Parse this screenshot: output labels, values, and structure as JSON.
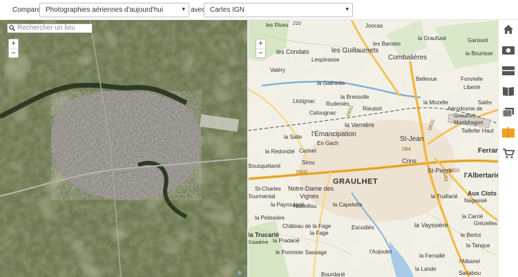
{
  "compare": {
    "label": "Comparer",
    "left_layer": "Photographies aériennes d'aujourd'hui",
    "sep": "avec",
    "right_layer": "Cartes IGN"
  },
  "search": {
    "placeholder": "Rechercher un lieu"
  },
  "zoom": {
    "in": "+",
    "out": "−"
  },
  "map_labels": [
    {
      "t": "les Rives"
    },
    {
      "t": "210"
    },
    {
      "t": "Joncas"
    },
    {
      "t": "la Graufusé"
    },
    {
      "t": "Garissol"
    },
    {
      "t": "les Condats"
    },
    {
      "t": "les Guillaumets"
    },
    {
      "t": "les Barotes"
    },
    {
      "t": "Combalières"
    },
    {
      "t": "la Bourisse"
    },
    {
      "t": "Lespinasse"
    },
    {
      "t": "Valéry"
    },
    {
      "t": "Bellevue"
    },
    {
      "t": "Fonvielle"
    },
    {
      "t": "Liberté"
    },
    {
      "t": "la Galinette"
    },
    {
      "t": "la Bressolle"
    },
    {
      "t": "Rudeniès"
    },
    {
      "t": "Lézignac"
    },
    {
      "t": "la Mozelle"
    },
    {
      "t": "Salès"
    },
    {
      "t": "Aérodrome de"
    },
    {
      "t": "Graulhet-"
    },
    {
      "t": "Montdragon"
    },
    {
      "t": "Catougnac"
    },
    {
      "t": "Rieutort"
    },
    {
      "t": "la Vernière"
    },
    {
      "t": "Taillefer Haut"
    },
    {
      "t": "l'Émancipation"
    },
    {
      "t": "la Salle"
    },
    {
      "t": "St-Jean"
    },
    {
      "t": "En Gach"
    },
    {
      "t": "Ferran"
    },
    {
      "t": "la Redondié"
    },
    {
      "t": "Carivel"
    },
    {
      "t": "Crins"
    },
    {
      "t": "Bousquétarié"
    },
    {
      "t": "Sirou"
    },
    {
      "t": "St-Pierre"
    },
    {
      "t": "l'Albertarié"
    },
    {
      "t": "GRAULHET"
    },
    {
      "t": "St-Charles"
    },
    {
      "t": "Notre-Dame des"
    },
    {
      "t": "Vignes"
    },
    {
      "t": "Aux Clots"
    },
    {
      "t": "Tourmental"
    },
    {
      "t": "la Payroularié"
    },
    {
      "t": "Nabeillou"
    },
    {
      "t": "la Capelette"
    },
    {
      "t": "la Truillarié"
    },
    {
      "t": "Nagassié"
    },
    {
      "t": "la Pelissière"
    },
    {
      "t": "la Carrié"
    },
    {
      "t": "Château de la Fage"
    },
    {
      "t": "la Fage"
    },
    {
      "t": "Escudiés"
    },
    {
      "t": "la Vayssière"
    },
    {
      "t": "Grèzelles"
    },
    {
      "t": "la Trucarié"
    },
    {
      "t": "la Pradarié"
    },
    {
      "t": "Estadière"
    },
    {
      "t": "le Berlut"
    },
    {
      "t": "le Pommier Sauvage"
    },
    {
      "t": "l'Aujoulet"
    },
    {
      "t": "la Ferraillé"
    },
    {
      "t": "la Tanque"
    },
    {
      "t": "l'Albanel"
    },
    {
      "t": "Sarlabou"
    },
    {
      "t": "Bourdarié"
    },
    {
      "t": "la Lande"
    }
  ],
  "road_numbers": [
    "D631",
    "D631",
    "D631",
    "D83",
    "D84",
    "D631"
  ],
  "toolbar": [
    "home-icon",
    "camera-icon",
    "layers-icon",
    "book-icon",
    "compare-icon",
    "pages-icon",
    "cart-icon"
  ],
  "colors": {
    "accent": "#f0a020",
    "toolbar_icon": "#555555"
  }
}
